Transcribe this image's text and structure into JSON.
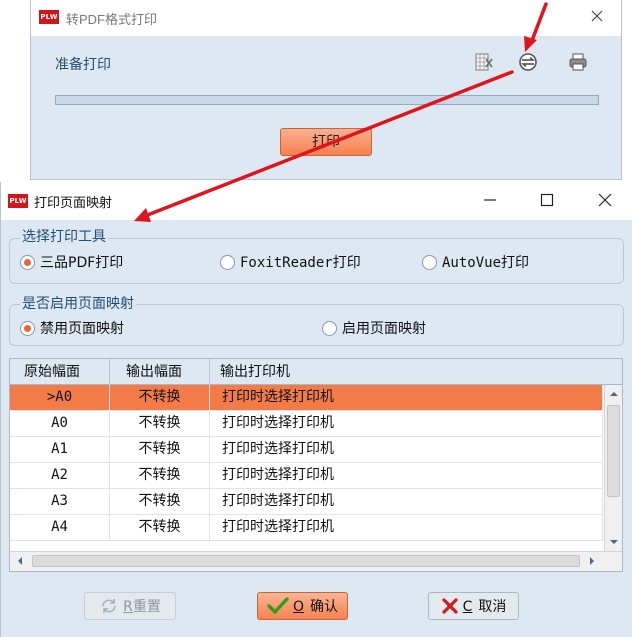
{
  "logo_text": "PLW",
  "back_window": {
    "title": "转PDF格式打印",
    "status": "准备打印",
    "progress": 0,
    "print_button": "打印",
    "toolbar_icons": [
      "excel-export-icon",
      "page-mapping-icon",
      "printer-icon"
    ]
  },
  "dialog": {
    "title": "打印页面映射",
    "print_tool_group": {
      "legend": "选择打印工具",
      "options": [
        "三品PDF打印",
        "FoxitReader打印",
        "AutoVue打印"
      ],
      "selected": "三品PDF打印"
    },
    "mapping_group": {
      "legend": "是否启用页面映射",
      "options": [
        "禁用页面映射",
        "启用页面映射"
      ],
      "selected": "禁用页面映射"
    },
    "table": {
      "columns": [
        "原始幅面",
        "输出幅面",
        "输出打印机"
      ],
      "rows": [
        [
          ">A0",
          "不转换",
          "打印时选择打印机"
        ],
        [
          "A0",
          "不转换",
          "打印时选择打印机"
        ],
        [
          "A1",
          "不转换",
          "打印时选择打印机"
        ],
        [
          "A2",
          "不转换",
          "打印时选择打印机"
        ],
        [
          "A3",
          "不转换",
          "打印时选择打印机"
        ],
        [
          "A4",
          "不转换",
          "打印时选择打印机"
        ]
      ],
      "selected_row": 0
    },
    "buttons": {
      "reset": {
        "key": "R",
        "label": "重置"
      },
      "ok": {
        "key": "O",
        "label": "确认"
      },
      "cancel": {
        "key": "C",
        "label": "取消"
      }
    }
  },
  "colors": {
    "accent_orange": "#f37b48",
    "panel_bg": "#dde8f2",
    "heading_blue": "#1f4e79",
    "annotation_red": "#e0141c"
  }
}
